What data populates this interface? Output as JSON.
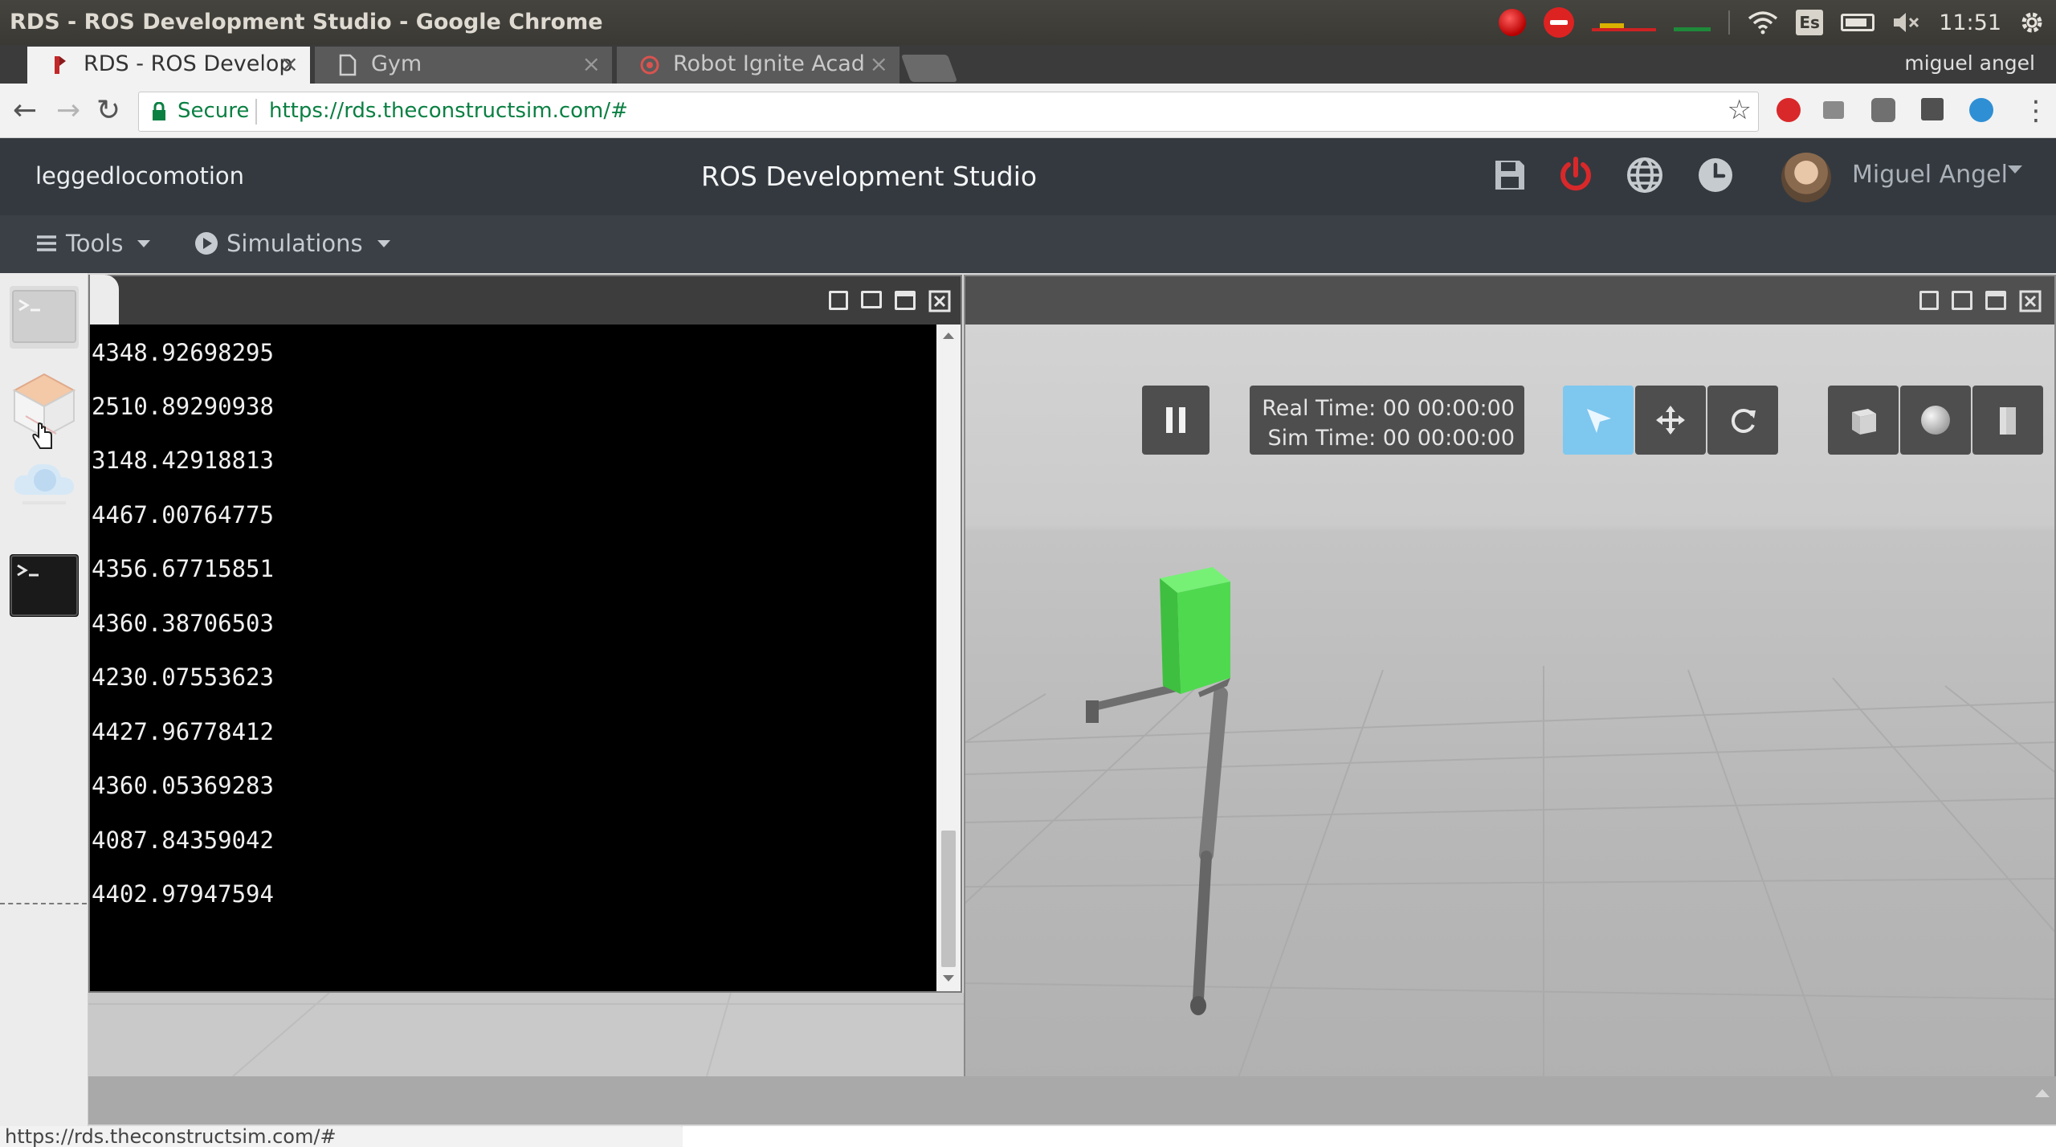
{
  "os": {
    "window_title": "RDS - ROS Development Studio - Google Chrome",
    "keyboard_layout": "Es",
    "clock": "11:51"
  },
  "browser": {
    "tabs": [
      {
        "label": "RDS - ROS Develop",
        "active": true,
        "icon": "rds-favicon-icon"
      },
      {
        "label": "Gym",
        "active": false,
        "icon": "document-icon"
      },
      {
        "label": "Robot Ignite Acad",
        "active": false,
        "icon": "robot-ignite-icon"
      }
    ],
    "profile_name": "miguel angel",
    "secure_label": "Secure",
    "url": "https://rds.theconstructsim.com/#",
    "status_url": "https://rds.theconstructsim.com/#"
  },
  "app": {
    "project_name": "leggedlocomotion",
    "title": "ROS Development Studio",
    "user_name": "Miguel Angel",
    "menu": {
      "tools_label": "Tools",
      "simulations_label": "Simulations"
    },
    "header_icons": [
      "save-icon",
      "power-icon",
      "globe-icon",
      "clock-icon"
    ],
    "accent_power": "#d9282a"
  },
  "terminal": {
    "lines": [
      "4348.92698295",
      "2510.89290938",
      "3148.42918813",
      "4467.00764775",
      "4356.67715851",
      "4360.38706503",
      "4230.07553623",
      "4427.96778412",
      "4360.05369283",
      "4087.84359042",
      "4402.97947594"
    ]
  },
  "gazebo": {
    "real_time_label": "Real Time:",
    "real_time": "00 00:00:00",
    "sim_time_label": "Sim Time:",
    "sim_time": "00 00:00:00",
    "active_tool_color": "#7ec7ef",
    "robot_body_color": "#4fd94f"
  }
}
